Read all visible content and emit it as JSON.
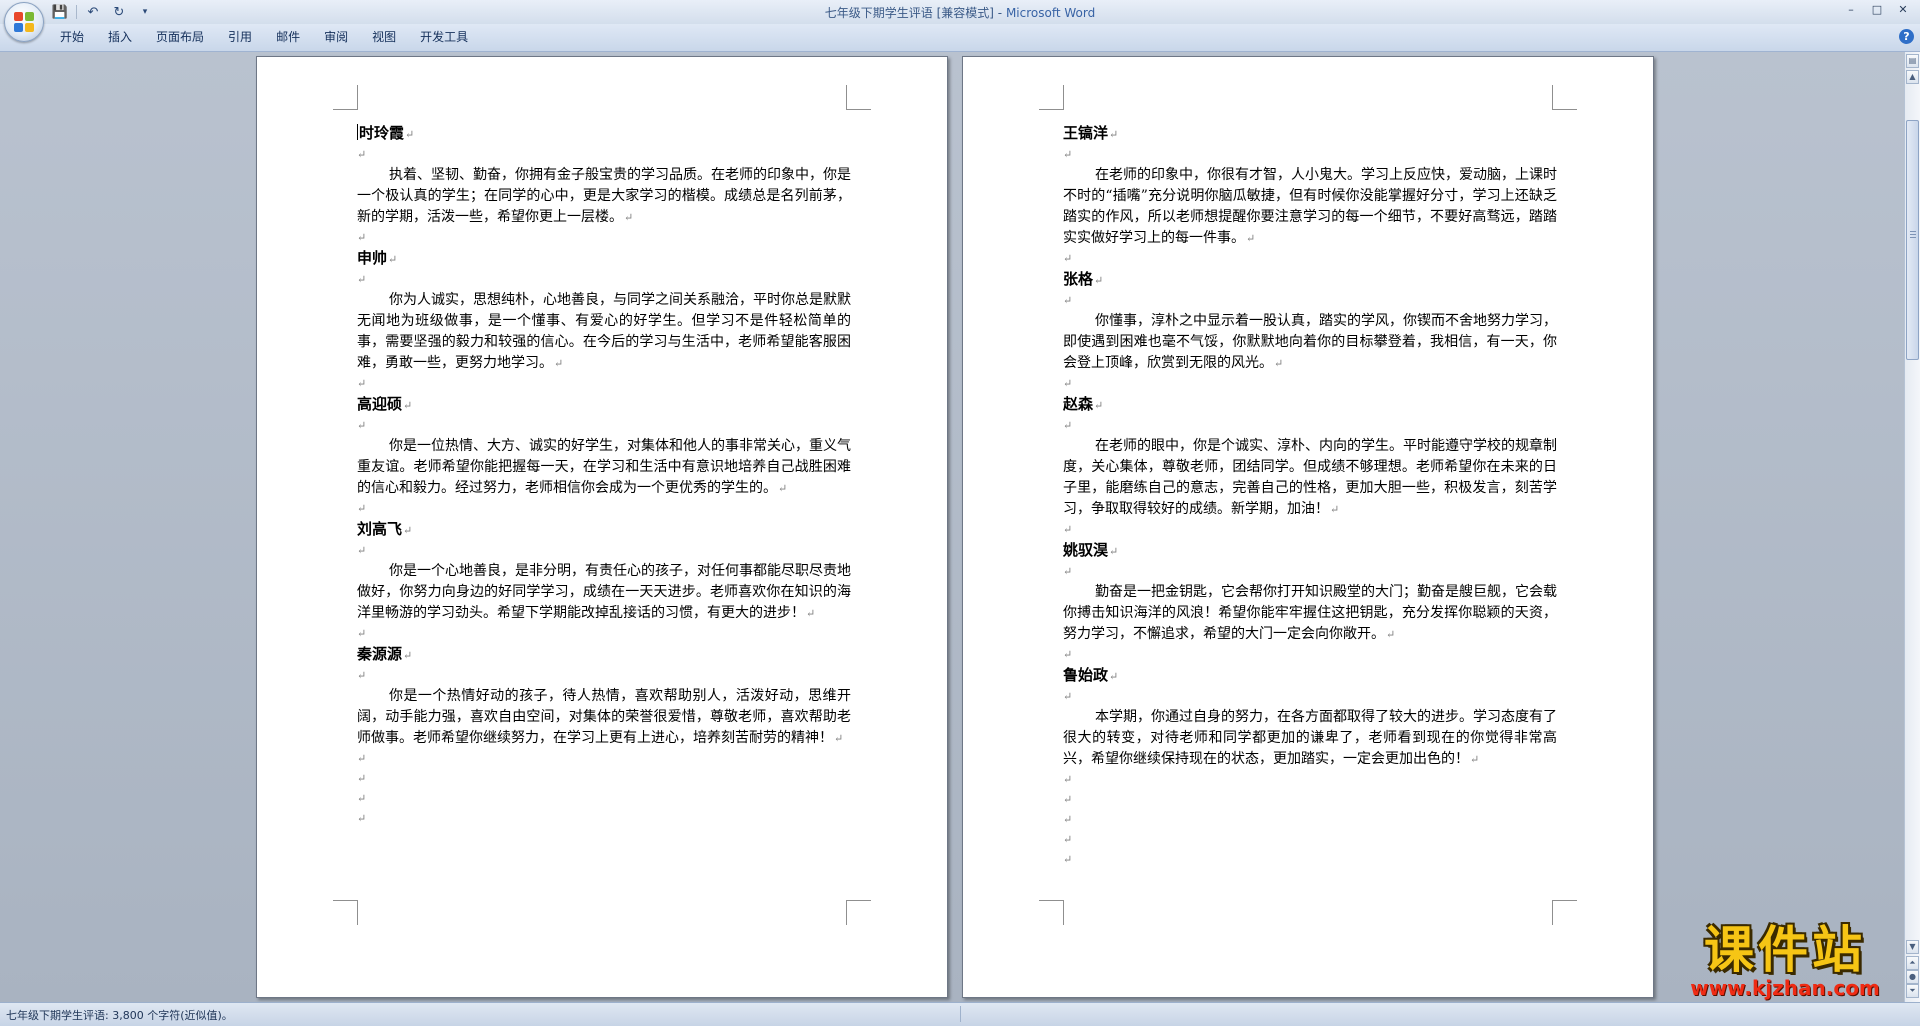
{
  "window": {
    "title_doc": "七年级下期学生评语 [兼容模式]",
    "title_sep": " - ",
    "title_app": "Microsoft Word",
    "controls": {
      "minimize": "–",
      "maximize": "□",
      "close": "✕"
    }
  },
  "quick_access": {
    "save": "💾",
    "undo": "↶",
    "redo": "↻",
    "customize": "▾"
  },
  "ribbon": {
    "tabs": [
      "开始",
      "插入",
      "页面布局",
      "引用",
      "邮件",
      "审阅",
      "视图",
      "开发工具"
    ],
    "help": "?"
  },
  "marks": {
    "para": "↵"
  },
  "pages": [
    {
      "entries": [
        {
          "name": "时玲霞",
          "text": "执着、坚韧、勤奋，你拥有金子般宝贵的学习品质。在老师的印象中，你是一个极认真的学生；在同学的心中，更是大家学习的楷模。成绩总是名列前茅，新的学期，活泼一些，希望你更上一层楼。"
        },
        {
          "name": "申帅",
          "text": "你为人诚实，思想纯朴，心地善良，与同学之间关系融洽，平时你总是默默无闻地为班级做事，是一个懂事、有爱心的好学生。但学习不是件轻松简单的事，需要坚强的毅力和较强的信心。在今后的学习与生活中，老师希望能客服困难，勇敢一些，更努力地学习。"
        },
        {
          "name": "高迎硕",
          "text": "你是一位热情、大方、诚实的好学生，对集体和他人的事非常关心，重义气重友谊。老师希望你能把握每一天，在学习和生活中有意识地培养自己战胜困难的信心和毅力。经过努力，老师相信你会成为一个更优秀的学生的。"
        },
        {
          "name": "刘高飞",
          "text": "你是一个心地善良，是非分明，有责任心的孩子，对任何事都能尽职尽责地做好，你努力向身边的好同学学习，成绩在一天天进步。老师喜欢你在知识的海洋里畅游的学习劲头。希望下学期能改掉乱接话的习惯，有更大的进步！"
        },
        {
          "name": "秦源源",
          "text": "你是一个热情好动的孩子，待人热情，喜欢帮助别人，活泼好动，思维开阔，动手能力强，喜欢自由空间，对集体的荣誉很爱惜，尊敬老师，喜欢帮助老师做事。老师希望你继续努力，在学习上更有上进心，培养刻苦耐劳的精神！"
        }
      ],
      "trailing_blank_lines": 4
    },
    {
      "entries": [
        {
          "name": "王镐洋",
          "text": "在老师的印象中，你很有才智，人小鬼大。学习上反应快，爱动脑，上课时不时的“插嘴”充分说明你脑瓜敏捷，但有时候你没能掌握好分寸，学习上还缺乏踏实的作风，所以老师想提醒你要注意学习的每一个细节，不要好高骛远，踏踏实实做好学习上的每一件事。"
        },
        {
          "name": "张格",
          "text": "你懂事，淳朴之中显示着一股认真，踏实的学风，你锲而不舍地努力学习，即使遇到困难也毫不气馁，你默默地向着你的目标攀登着，我相信，有一天，你会登上顶峰，欣赏到无限的风光。"
        },
        {
          "name": "赵森",
          "text": "在老师的眼中，你是个诚实、淳朴、内向的学生。平时能遵守学校的规章制度，关心集体，尊敬老师，团结同学。但成绩不够理想。老师希望你在未来的日子里，能磨练自己的意志，完善自己的性格，更加大胆一些，积极发言，刻苦学习，争取取得较好的成绩。新学期，加油！"
        },
        {
          "name": "姚驭淏",
          "text": "勤奋是一把金钥匙，它会帮你打开知识殿堂的大门；勤奋是艘巨舰，它会载你搏击知识海洋的风浪！希望你能牢牢握住这把钥匙，充分发挥你聪颖的天资，努力学习，不懈追求，希望的大门一定会向你敞开。"
        },
        {
          "name": "鲁始政",
          "text": "本学期，你通过自身的努力，在各方面都取得了较大的进步。学习态度有了很大的转变，对待老师和同学都更加的谦卑了，老师看到现在的你觉得非常高兴，希望你继续保持现在的状态，更加踏实，一定会更加出色的！"
        }
      ],
      "trailing_blank_lines": 5
    }
  ],
  "statusbar": {
    "text": "七年级下期学生评语: 3,800 个字符(近似值)。"
  },
  "watermark": {
    "main": "课件站",
    "url": "www.kjzhan.com"
  },
  "colors": {
    "accent": "#3863a5",
    "watermark_yellow": "#f6c515",
    "watermark_red": "#ef2b14"
  }
}
